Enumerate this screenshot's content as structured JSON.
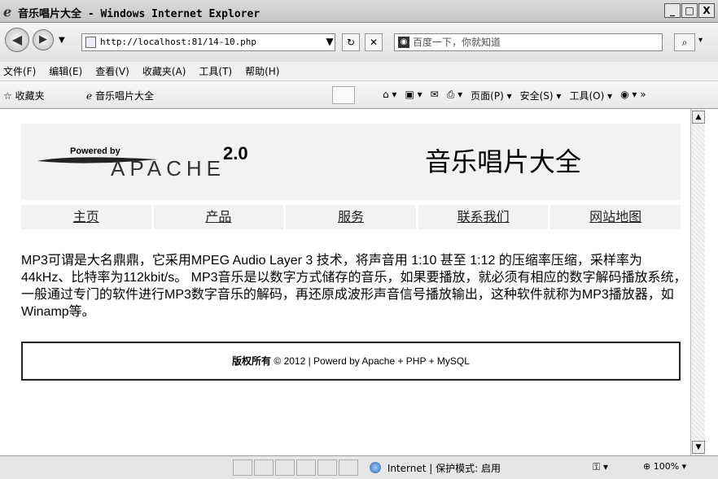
{
  "window": {
    "title": "音乐唱片大全 - Windows Internet Explorer",
    "minimize": "_",
    "maximize": "□",
    "close": "X"
  },
  "address": {
    "url": "http://localhost:81/14-10.php",
    "search_placeholder": "百度一下，你就知道"
  },
  "menu": [
    "文件(F)",
    "编辑(E)",
    "查看(V)",
    "收藏夹(A)",
    "工具(T)",
    "帮助(H)"
  ],
  "favorites": {
    "label": "收藏夹",
    "tab_title": "音乐唱片大全",
    "commands": [
      "页面(P) ▾",
      "安全(S) ▾",
      "工具(O) ▾"
    ]
  },
  "page": {
    "logo": {
      "powered_by": "Powered by",
      "version": "2.0",
      "word": "APACHE"
    },
    "site_title": "音乐唱片大全",
    "nav": [
      "主页",
      "产品",
      "服务",
      "联系我们",
      "网站地图"
    ],
    "article": "MP3可谓是大名鼎鼎，它采用MPEG Audio Layer 3 技术，将声音用 1:10 甚至 1:12 的压缩率压缩，采样率为44kHz、比特率为112kbit/s。 MP3音乐是以数字方式储存的音乐，如果要播放，就必须有相应的数字解码播放系统，一般通过专门的软件进行MP3数字音乐的解码，再还原成波形声音信号播放输出，这种软件就称为MP3播放器，如Winamp等。",
    "footer_bold": "版权所有",
    "footer_rest": " © 2012  |  Powerd by Apache + PHP + MySQL"
  },
  "status": {
    "zone": "Internet | 保护模式: 启用",
    "zoom": "100%"
  }
}
